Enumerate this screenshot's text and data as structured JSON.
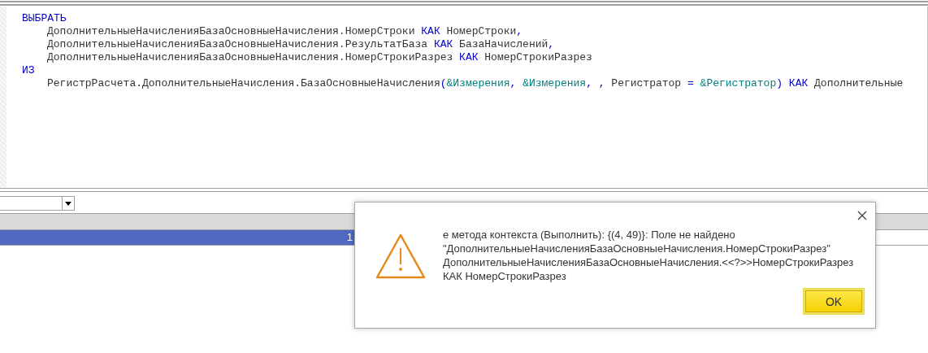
{
  "editor": {
    "lines": [
      {
        "indented": false,
        "tokens": [
          {
            "kind": "keyword",
            "text": "ВЫБРАТЬ"
          }
        ]
      },
      {
        "indented": true,
        "tokens": [
          {
            "kind": "plain",
            "text": "ДополнительныеНачисленияБазаОсновныеНачисления.НомерСтроки "
          },
          {
            "kind": "keyword",
            "text": "КАК"
          },
          {
            "kind": "plain",
            "text": " НомерСтроки"
          },
          {
            "kind": "operator",
            "text": ","
          }
        ]
      },
      {
        "indented": true,
        "tokens": [
          {
            "kind": "plain",
            "text": "ДополнительныеНачисленияБазаОсновныеНачисления.РезультатБаза "
          },
          {
            "kind": "keyword",
            "text": "КАК"
          },
          {
            "kind": "plain",
            "text": " БазаНачислений"
          },
          {
            "kind": "operator",
            "text": ","
          }
        ]
      },
      {
        "indented": true,
        "tokens": [
          {
            "kind": "plain",
            "text": "ДополнительныеНачисленияБазаОсновныеНачисления.НомерСтрокиРазрез "
          },
          {
            "kind": "keyword",
            "text": "КАК"
          },
          {
            "kind": "plain",
            "text": " НомерСтрокиРазрез"
          }
        ]
      },
      {
        "indented": false,
        "tokens": [
          {
            "kind": "keyword",
            "text": "ИЗ"
          }
        ]
      },
      {
        "indented": true,
        "tokens": [
          {
            "kind": "plain",
            "text": "РегистрРасчета.ДополнительныеНачисления.БазаОсновныеНачисления"
          },
          {
            "kind": "operator",
            "text": "("
          },
          {
            "kind": "param",
            "text": "&Измерения"
          },
          {
            "kind": "operator",
            "text": ", "
          },
          {
            "kind": "param",
            "text": "&Измерения"
          },
          {
            "kind": "operator",
            "text": ", , "
          },
          {
            "kind": "plain",
            "text": "Регистратор "
          },
          {
            "kind": "operator",
            "text": "= "
          },
          {
            "kind": "param",
            "text": "&Регистратор"
          },
          {
            "kind": "operator",
            "text": ") "
          },
          {
            "kind": "keyword",
            "text": "КАК"
          },
          {
            "kind": "plain",
            "text": " Дополнительные"
          }
        ]
      }
    ]
  },
  "table": {
    "rows": [
      {
        "cell": "1",
        "selected": true
      }
    ]
  },
  "dialog": {
    "message": "е метода контекста (Выполнить): {(4, 49)}: Поле не найдено\n\"ДополнительныеНачисленияБазаОсновныеНачисления.НомерСтрокиРазрез\"\nДополнительныеНачисленияБазаОсновныеНачисления.<<?>>НомерСтрокиРазрез\nКАК НомерСтрокиРазрез",
    "button": "OK"
  }
}
